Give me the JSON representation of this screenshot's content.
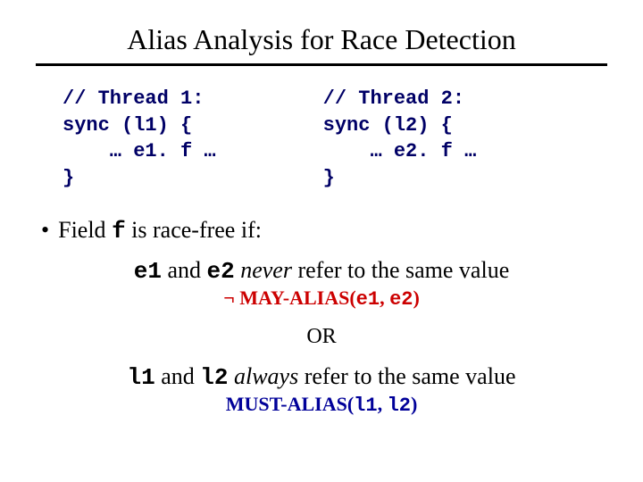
{
  "title": "Alias Analysis for Race Detection",
  "code_left": "// Thread 1:\nsync (l1) {\n    … e1. f …\n}",
  "code_right": "// Thread 2:\nsync (l2) {\n    … e2. f …\n}",
  "bullet_prefix": "Field ",
  "bullet_code": "f",
  "bullet_suffix": " is race-free if:",
  "cond1_e1": "e1",
  "cond1_mid": " and ",
  "cond1_e2": "e2",
  "cond1_space": " ",
  "cond1_never": "never",
  "cond1_tail": " refer to the same value",
  "cond1_sub_neg": "¬ ",
  "cond1_sub_func": "MAY-ALIAS(",
  "cond1_sub_a": "e1",
  "cond1_sub_comma": ", ",
  "cond1_sub_b": "e2",
  "cond1_sub_close": ")",
  "or_text": "OR",
  "cond2_l1": "l1",
  "cond2_mid": " and ",
  "cond2_l2": "l2",
  "cond2_space": " ",
  "cond2_always": "always",
  "cond2_tail": " refer to the same value",
  "cond2_sub_func": "MUST-ALIAS(",
  "cond2_sub_a": "l1",
  "cond2_sub_comma": ", ",
  "cond2_sub_b": "l2",
  "cond2_sub_close": ")"
}
